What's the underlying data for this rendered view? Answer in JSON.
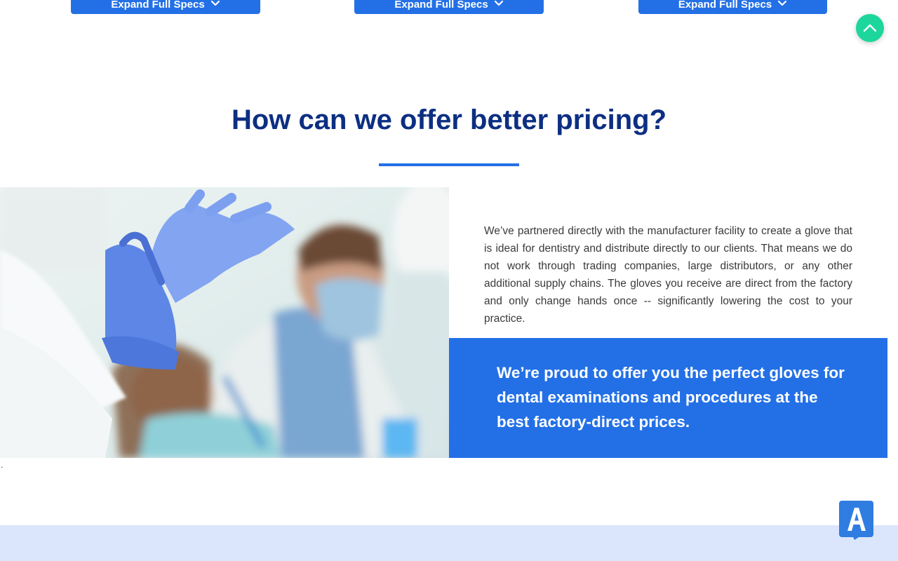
{
  "spec_buttons": [
    {
      "label": "Expand Full Specs"
    },
    {
      "label": "Expand Full Specs"
    },
    {
      "label": "Expand Full Specs"
    }
  ],
  "icons": {
    "scroll_top": "chevron-up-icon",
    "spec_chevron": "chevron-down-icon",
    "accessibility": "letter-a-badge-icon"
  },
  "pricing": {
    "title": "How can we offer better pricing?",
    "body": "We’ve partnered directly with the manufacturer facility to create a glove that is ideal for dentistry and distribute directly to our clients. That means we do not work through trading companies, large distributors, or any other additional supply chains. The gloves you receive are direct from the factory and only change hands once -- significantly lowering the cost to your practice.",
    "callout": "We’re proud to offer you the perfect gloves for dental examinations and procedures at the best factory-direct prices."
  },
  "stray_text": ".",
  "colors": {
    "accent_blue": "#2370e6",
    "title_navy": "#0c2f82",
    "scroll_top_green": "#1dd69b",
    "footer_band": "#dbe6fd"
  }
}
